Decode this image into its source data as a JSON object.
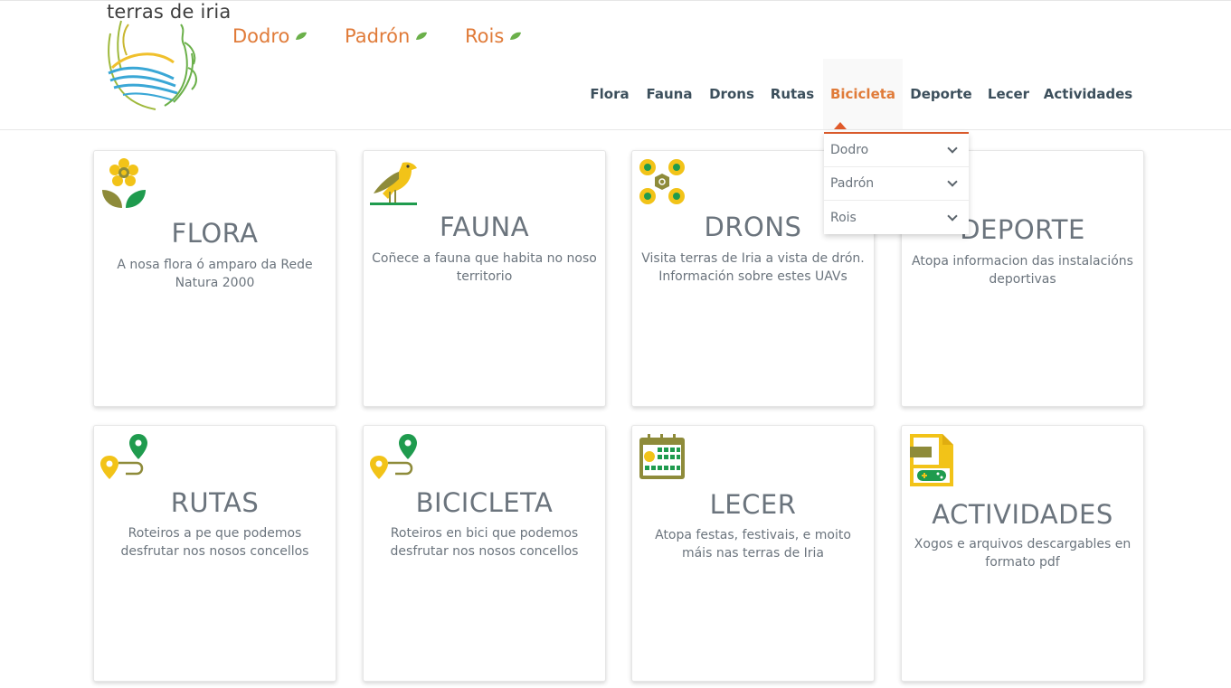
{
  "site": {
    "name": "terras de iria"
  },
  "towns": [
    {
      "label": "Dodro"
    },
    {
      "label": "Padrón"
    },
    {
      "label": "Rois"
    }
  ],
  "nav": {
    "items": [
      {
        "label": "Flora"
      },
      {
        "label": "Fauna"
      },
      {
        "label": "Drons"
      },
      {
        "label": "Rutas"
      },
      {
        "label": "Bicicleta",
        "active": true
      },
      {
        "label": "Deporte"
      },
      {
        "label": "Lecer"
      },
      {
        "label": "Actividades"
      }
    ]
  },
  "dropdown": {
    "items": [
      {
        "label": "Dodro"
      },
      {
        "label": "Padrón"
      },
      {
        "label": "Rois"
      }
    ]
  },
  "cards": [
    {
      "title": "FLORA",
      "desc": "A nosa flora ó amparo da Rede Natura 2000",
      "icon": "flower-icon"
    },
    {
      "title": "FAUNA",
      "desc": "Coñece a fauna que habita no noso territorio",
      "icon": "bird-icon"
    },
    {
      "title": "DRONS",
      "desc": "Visita terras de Iria a vista de drón. Información sobre estes UAVs",
      "icon": "drone-icon"
    },
    {
      "title": "DEPORTE",
      "desc": "Atopa informacion das instalacións deportivas",
      "icon": ""
    },
    {
      "title": "RUTAS",
      "desc": "Roteiros a pe que podemos desfrutar nos nosos concellos",
      "icon": "route-icon"
    },
    {
      "title": "BICICLETA",
      "desc": "Roteiros en bici que podemos desfrutar nos nosos concellos",
      "icon": "route-icon"
    },
    {
      "title": "LECER",
      "desc": "Atopa festas, festivais, e moito máis nas terras de Iria",
      "icon": "calendar-icon"
    },
    {
      "title": "ACTIVIDADES",
      "desc": "Xogos e arquivos descargables en formato pdf",
      "icon": "game-file-icon"
    }
  ],
  "colors": {
    "accent_orange": "#e07b39",
    "nav_text": "#3c4f5c",
    "icon_yellow": "#f2c318",
    "icon_olive": "#8e8b3a",
    "icon_green": "#1f9b4e"
  }
}
